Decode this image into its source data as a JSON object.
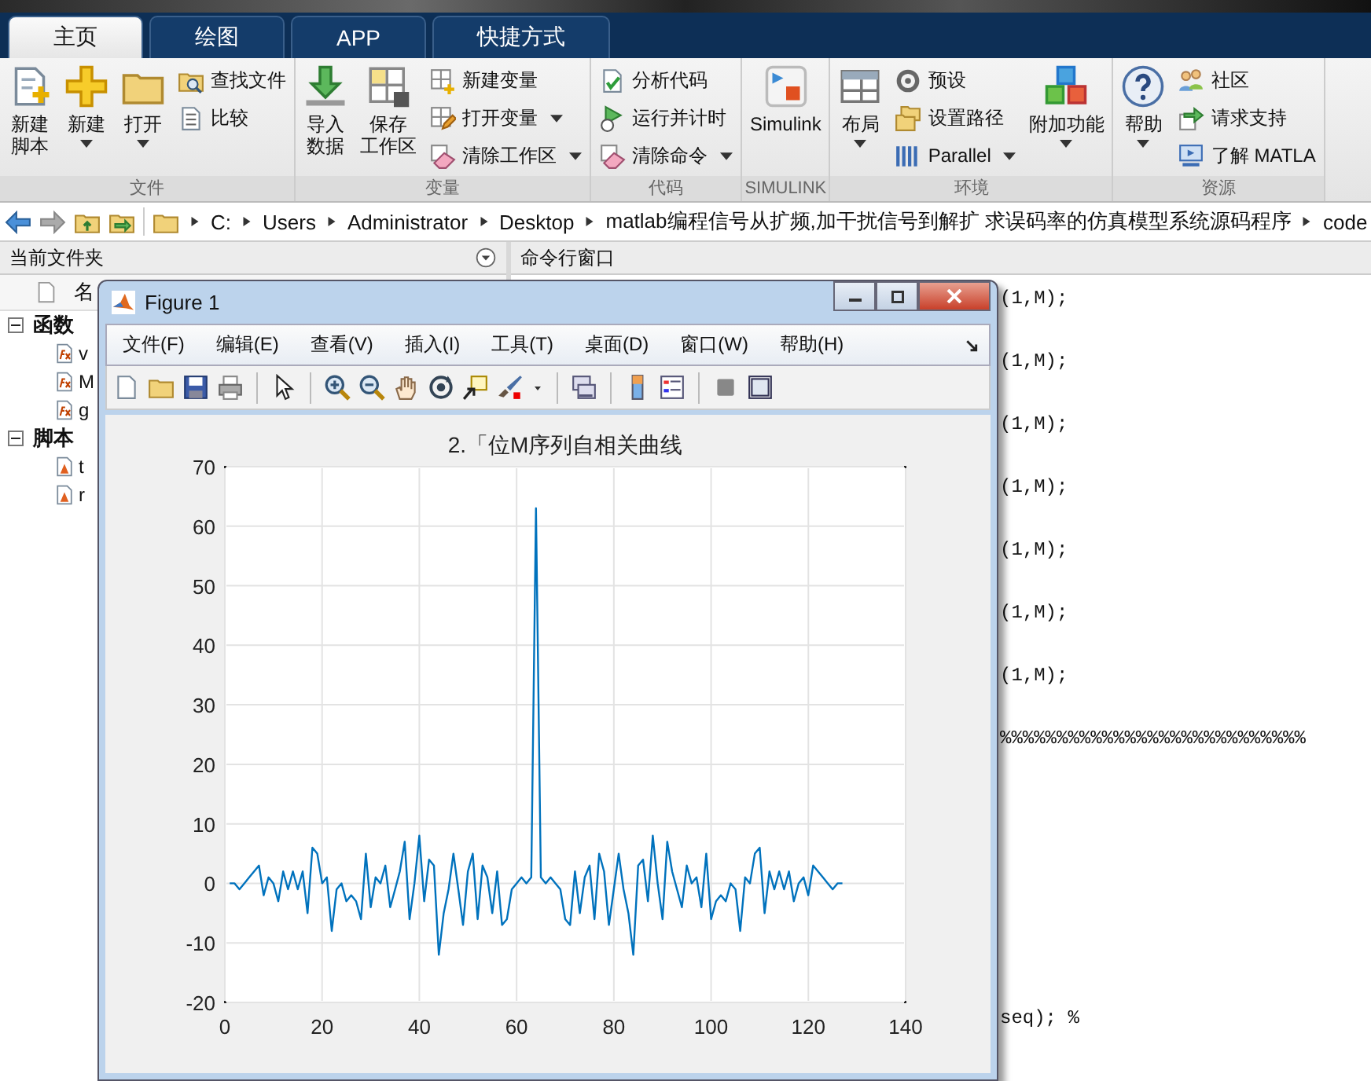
{
  "tabs": [
    {
      "label": "主页",
      "selected": true
    },
    {
      "label": "绘图",
      "selected": false
    },
    {
      "label": "APP",
      "selected": false
    },
    {
      "label": "快捷方式",
      "selected": false
    }
  ],
  "ribbon": {
    "groups": [
      {
        "label": "文件",
        "items": [
          {
            "kind": "large",
            "lines": [
              "新建",
              "脚本"
            ],
            "dropdown": false
          },
          {
            "kind": "large",
            "lines": [
              "新建"
            ],
            "dropdown": true
          },
          {
            "kind": "large",
            "lines": [
              "打开"
            ],
            "dropdown": true
          },
          {
            "kind": "small",
            "label": "查找文件",
            "dropdown": false
          },
          {
            "kind": "small",
            "label": "比较",
            "dropdown": false
          }
        ]
      },
      {
        "label": "变量",
        "items": [
          {
            "kind": "large",
            "lines": [
              "导入",
              "数据"
            ],
            "dropdown": false
          },
          {
            "kind": "large",
            "lines": [
              "保存",
              "工作区"
            ],
            "dropdown": false
          },
          {
            "kind": "small",
            "label": "新建变量",
            "dropdown": false
          },
          {
            "kind": "small",
            "label": "打开变量",
            "dropdown": true
          },
          {
            "kind": "small",
            "label": "清除工作区",
            "dropdown": true
          }
        ]
      },
      {
        "label": "代码",
        "items": [
          {
            "kind": "small",
            "label": "分析代码",
            "dropdown": false
          },
          {
            "kind": "small",
            "label": "运行并计时",
            "dropdown": false
          },
          {
            "kind": "small",
            "label": "清除命令",
            "dropdown": true
          }
        ]
      },
      {
        "label": "SIMULINK",
        "items": [
          {
            "kind": "large",
            "lines": [
              "Simulink"
            ],
            "dropdown": false
          }
        ]
      },
      {
        "label": "环境",
        "items": [
          {
            "kind": "large",
            "lines": [
              "布局"
            ],
            "dropdown": true
          },
          {
            "kind": "small",
            "label": "预设",
            "dropdown": false
          },
          {
            "kind": "small",
            "label": "设置路径",
            "dropdown": false
          },
          {
            "kind": "small",
            "label": "Parallel",
            "dropdown": true
          },
          {
            "kind": "large",
            "lines": [
              "附加功能"
            ],
            "dropdown": true
          }
        ]
      },
      {
        "label": "资源",
        "items": [
          {
            "kind": "large",
            "lines": [
              "帮助"
            ],
            "dropdown": true
          },
          {
            "kind": "small",
            "label": "社区",
            "dropdown": false
          },
          {
            "kind": "small",
            "label": "请求支持",
            "dropdown": false
          },
          {
            "kind": "small",
            "label": "了解 MATLA",
            "dropdown": false
          }
        ]
      }
    ]
  },
  "address_bar": {
    "path": [
      "C:",
      "Users",
      "Administrator",
      "Desktop",
      "matlab编程信号从扩频,加干扰信号到解扩 求误码率的仿真模型系统源码程序",
      "code"
    ]
  },
  "current_folder": {
    "title": "当前文件夹",
    "column_header": "名",
    "sections": [
      {
        "label": "函数",
        "kind": "function",
        "expanded": true,
        "children": [
          {
            "label": "v"
          },
          {
            "label": "M"
          },
          {
            "label": "g"
          }
        ]
      },
      {
        "label": "脚本",
        "kind": "script",
        "expanded": true,
        "children": [
          {
            "label": "t"
          },
          {
            "label": "r"
          }
        ]
      }
    ]
  },
  "command_window": {
    "title": "命令行窗口",
    "lines": [
      "(1,M);",
      "(1,M);",
      "(1,M);",
      "(1,M);",
      "(1,M);",
      "(1,M);",
      "(1,M);",
      "%%%%%%%%%%%%%%%%%%%%%%%%%%%",
      "seq); %"
    ]
  },
  "figure": {
    "title": "Figure 1",
    "menu": [
      "文件(F)",
      "编辑(E)",
      "查看(V)",
      "插入(I)",
      "工具(T)",
      "桌面(D)",
      "窗口(W)",
      "帮助(H)"
    ],
    "chart_data": {
      "type": "line",
      "title": "2.「位M序列自相关曲线",
      "x": [
        1,
        2,
        3,
        4,
        5,
        6,
        7,
        8,
        9,
        10,
        11,
        12,
        13,
        14,
        15,
        16,
        17,
        18,
        19,
        20,
        21,
        22,
        23,
        24,
        25,
        26,
        27,
        28,
        29,
        30,
        31,
        32,
        33,
        34,
        35,
        36,
        37,
        38,
        39,
        40,
        41,
        42,
        43,
        44,
        45,
        46,
        47,
        48,
        49,
        50,
        51,
        52,
        53,
        54,
        55,
        56,
        57,
        58,
        59,
        60,
        61,
        62,
        63,
        64,
        65,
        66,
        67,
        68,
        69,
        70,
        71,
        72,
        73,
        74,
        75,
        76,
        77,
        78,
        79,
        80,
        81,
        82,
        83,
        84,
        85,
        86,
        87,
        88,
        89,
        90,
        91,
        92,
        93,
        94,
        95,
        96,
        97,
        98,
        99,
        100,
        101,
        102,
        103,
        104,
        105,
        106,
        107,
        108,
        109,
        110,
        111,
        112,
        113,
        114,
        115,
        116,
        117,
        118,
        119,
        120,
        121,
        122,
        123,
        124,
        125,
        126,
        127
      ],
      "series": [
        {
          "color": "#0072bd",
          "values": [
            0,
            0,
            -1,
            0,
            1,
            2,
            3,
            -2,
            1,
            0,
            -3,
            2,
            -1,
            2,
            -1,
            2,
            -5,
            6,
            5,
            0,
            1,
            -8,
            -1,
            0,
            -3,
            -2,
            -3,
            -6,
            5,
            -4,
            1,
            0,
            3,
            -4,
            -1,
            2,
            7,
            -6,
            0,
            8,
            -3,
            4,
            3,
            -12,
            -5,
            -1,
            5,
            -1,
            -7,
            2,
            5,
            -6,
            3,
            1,
            -5,
            2,
            -7,
            -6,
            -1,
            0,
            1,
            0,
            1,
            63,
            1,
            0,
            1,
            0,
            -1,
            -6,
            -7,
            2,
            -5,
            1,
            3,
            -6,
            5,
            2,
            -7,
            -1,
            5,
            -1,
            -5,
            -12,
            3,
            4,
            -3,
            8,
            0,
            -6,
            7,
            2,
            -1,
            -4,
            3,
            0,
            1,
            -4,
            5,
            -6,
            -3,
            -2,
            -3,
            0,
            -1,
            -8,
            1,
            0,
            5,
            6,
            -5,
            2,
            -1,
            2,
            -1,
            2,
            -3,
            0,
            1,
            -2,
            3,
            2,
            1,
            0,
            -1,
            0,
            0
          ]
        }
      ],
      "grid": true,
      "xlim": [
        0,
        140
      ],
      "ylim": [
        -20,
        70
      ],
      "xticks": [
        0,
        20,
        40,
        60,
        80,
        100,
        120,
        140
      ],
      "yticks": [
        -20,
        -10,
        0,
        10,
        20,
        30,
        40,
        50,
        60,
        70
      ]
    }
  }
}
